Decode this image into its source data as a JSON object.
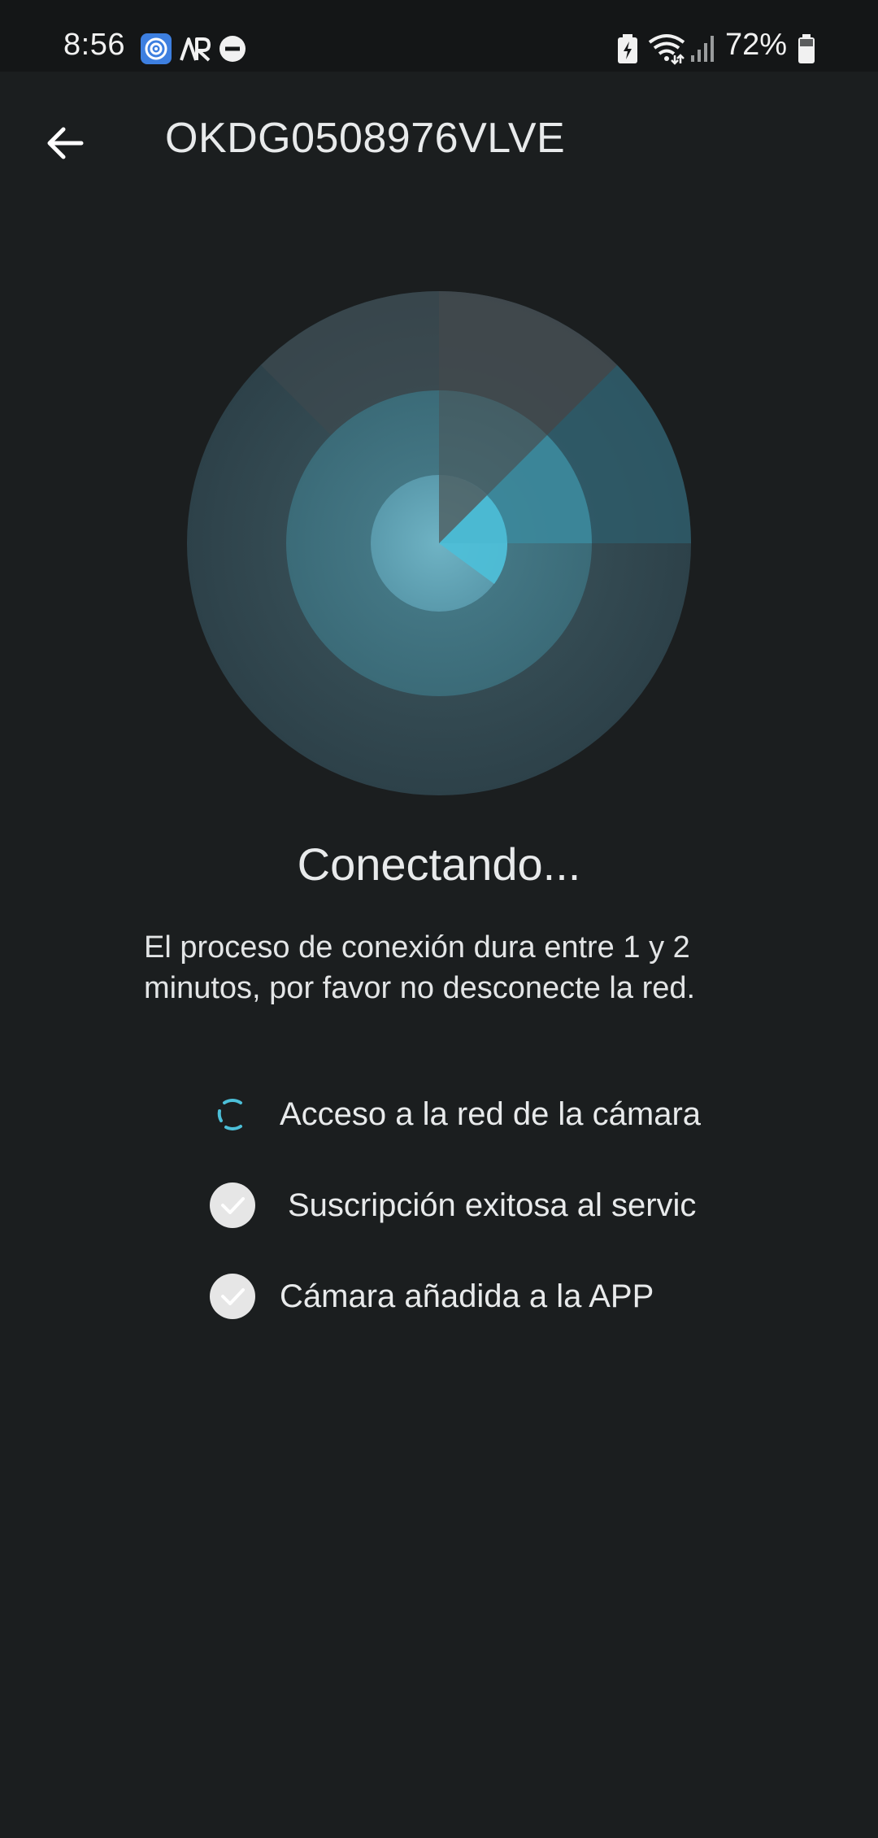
{
  "status_bar": {
    "time": "8:56",
    "battery_percent": "72%",
    "icons": [
      "app-notification-icon",
      "ar-icon",
      "do-not-disturb-icon",
      "battery-saver-icon",
      "wifi-icon",
      "signal-icon",
      "battery-icon"
    ]
  },
  "header": {
    "title": "OKDG0508976VLVE",
    "back_icon": "arrow-left-icon"
  },
  "main": {
    "heading": "Conectando...",
    "description_line1": "El proceso de conexión dura entre 1 y 2",
    "description_line2": "minutos, por favor no desconecte la red.",
    "steps": [
      {
        "label": "Acceso a la red de la cámara",
        "state": "loading",
        "icon": "spinner-icon"
      },
      {
        "label": "Suscripción exitosa al servic",
        "state": "done",
        "icon": "check-circle-icon"
      },
      {
        "label": "Cámara añadida a la APP",
        "state": "done",
        "icon": "check-circle-icon"
      }
    ]
  },
  "colors": {
    "background": "#1b1e1f",
    "accent": "#4cbfd8",
    "text": "#e8eaeb"
  }
}
